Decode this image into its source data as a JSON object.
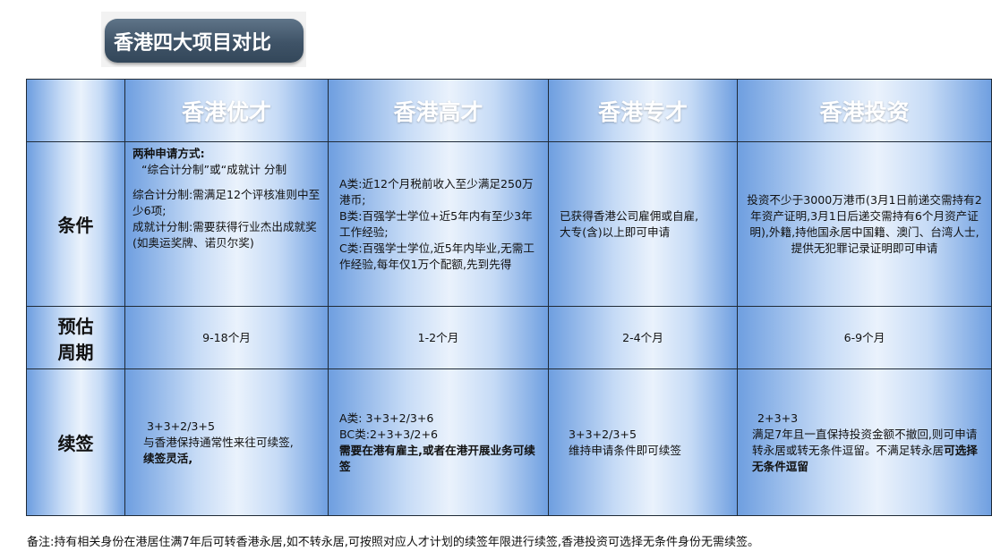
{
  "title": "香港四大项目对比",
  "headers": [
    "香港优才",
    "香港高才",
    "香港专才",
    "香港投资"
  ],
  "rows": {
    "conditions": {
      "label": "条件",
      "youcai": {
        "heading": "两种申请方式:",
        "lines": [
          "“综合计分制”或“成就计 分制",
          "",
          "综合计分制:需满足12个评核准则中至少6项;",
          "成就计分制:需要获得行业杰出成就奖(如奥运奖牌、诺贝尔奖)"
        ]
      },
      "gaocai": {
        "lines": [
          "A类:近12个月税前收入至少满足250万 港币;",
          "B类:百强学士学位+近5年内有至少3年工作经验;",
          "C类:百强学士学位,近5年内毕业,无需工作经验,每年仅1万个配额,先到先得"
        ]
      },
      "zhuancai": {
        "lines": [
          "已获得香港公司雇佣或自雇,",
          "大专(含)以上即可申请"
        ]
      },
      "touzi": {
        "lines": [
          "投资不少于3000万港币(3月1日前递交需持有2年资产证明,3月1日后递交需持有6个月资产证明),外籍,持他国永居中国籍、澳门、台湾人士,提供无犯罪记录证明即可申请"
        ]
      }
    },
    "period": {
      "label_line1": "预估",
      "label_line2": "周期",
      "values": [
        "9-18个月",
        "1-2个月",
        "2-4个月",
        "6-9个月"
      ]
    },
    "renewal": {
      "label": "续签",
      "youcai": {
        "formula": "3+3+2/3+5",
        "text": "与香港保持通常性来往可续签,",
        "bold": "续签灵活,"
      },
      "gaocai": {
        "a": "A类:   3+3+2/3+6",
        "bc": "BC类:2+3+3/2+6",
        "bold": "需要在港有雇主,或者在港开展业务可续签"
      },
      "zhuancai": {
        "formula": "3+3+2/3+5",
        "text": "维持申请条件即可续签"
      },
      "touzi": {
        "formula": "2+3+3",
        "text": "满足7年且一直保持投资金额不撤回,则可申请转永居或转无条件逗留。不满足转永居",
        "bold": "可选择无条件逗留"
      }
    }
  },
  "note": "备注:持有相关身份在港居住满7年后可转香港永居,如不转永居,可按照对应人才计划的续签年限进行续签,香港投资可选择无条件身份无需续签。"
}
